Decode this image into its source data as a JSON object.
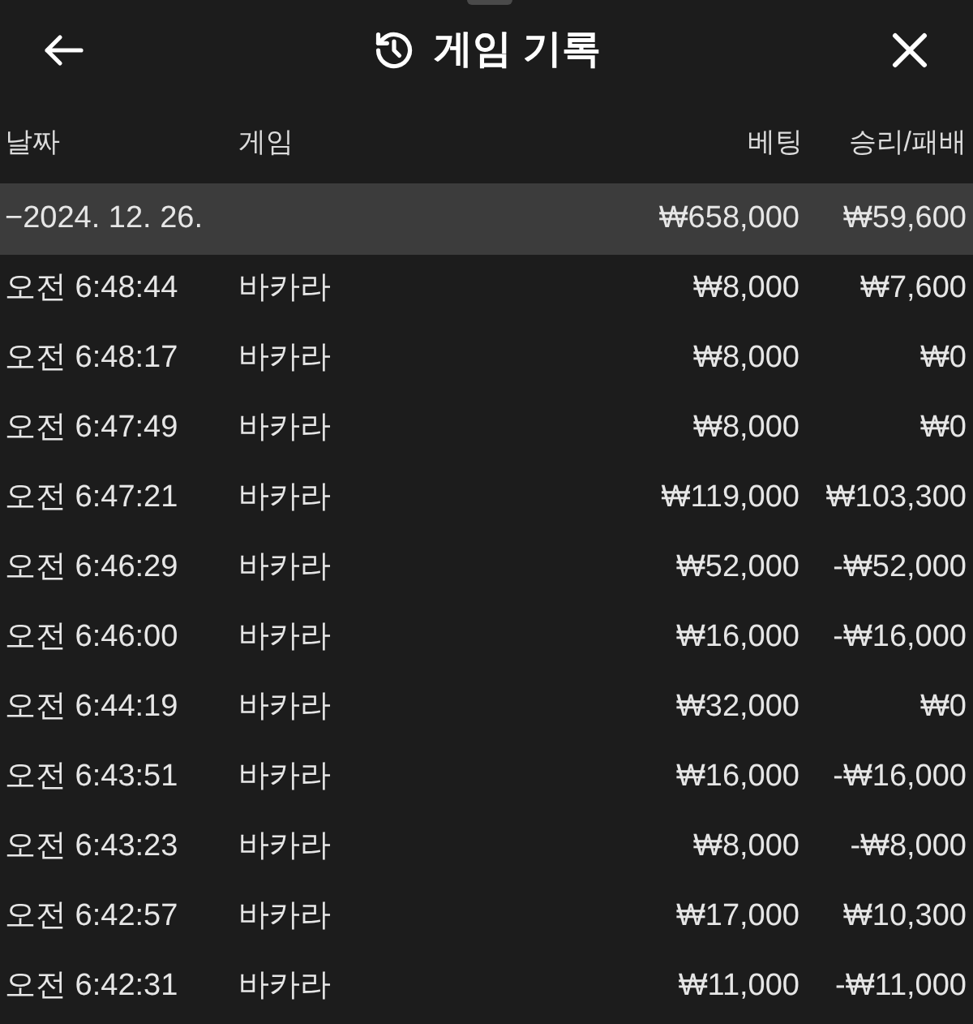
{
  "header": {
    "title": "게임 기록"
  },
  "columns": [
    "날짜",
    "게임",
    "베팅",
    "승리/패배"
  ],
  "group": {
    "date": "−2024. 12. 26.",
    "bet": "₩658,000",
    "result": "₩59,600",
    "expanded": true
  },
  "rows": [
    {
      "time": "오전 6:48:44",
      "game": "바카라",
      "bet": "₩8,000",
      "result": "₩7,600"
    },
    {
      "time": "오전 6:48:17",
      "game": "바카라",
      "bet": "₩8,000",
      "result": "₩0"
    },
    {
      "time": "오전 6:47:49",
      "game": "바카라",
      "bet": "₩8,000",
      "result": "₩0"
    },
    {
      "time": "오전 6:47:21",
      "game": "바카라",
      "bet": "₩119,000",
      "result": "₩103,300"
    },
    {
      "time": "오전 6:46:29",
      "game": "바카라",
      "bet": "₩52,000",
      "result": "-₩52,000"
    },
    {
      "time": "오전 6:46:00",
      "game": "바카라",
      "bet": "₩16,000",
      "result": "-₩16,000"
    },
    {
      "time": "오전 6:44:19",
      "game": "바카라",
      "bet": "₩32,000",
      "result": "₩0"
    },
    {
      "time": "오전 6:43:51",
      "game": "바카라",
      "bet": "₩16,000",
      "result": "-₩16,000"
    },
    {
      "time": "오전 6:43:23",
      "game": "바카라",
      "bet": "₩8,000",
      "result": "-₩8,000"
    },
    {
      "time": "오전 6:42:57",
      "game": "바카라",
      "bet": "₩17,000",
      "result": "₩10,300"
    },
    {
      "time": "오전 6:42:31",
      "game": "바카라",
      "bet": "₩11,000",
      "result": "-₩11,000"
    }
  ]
}
